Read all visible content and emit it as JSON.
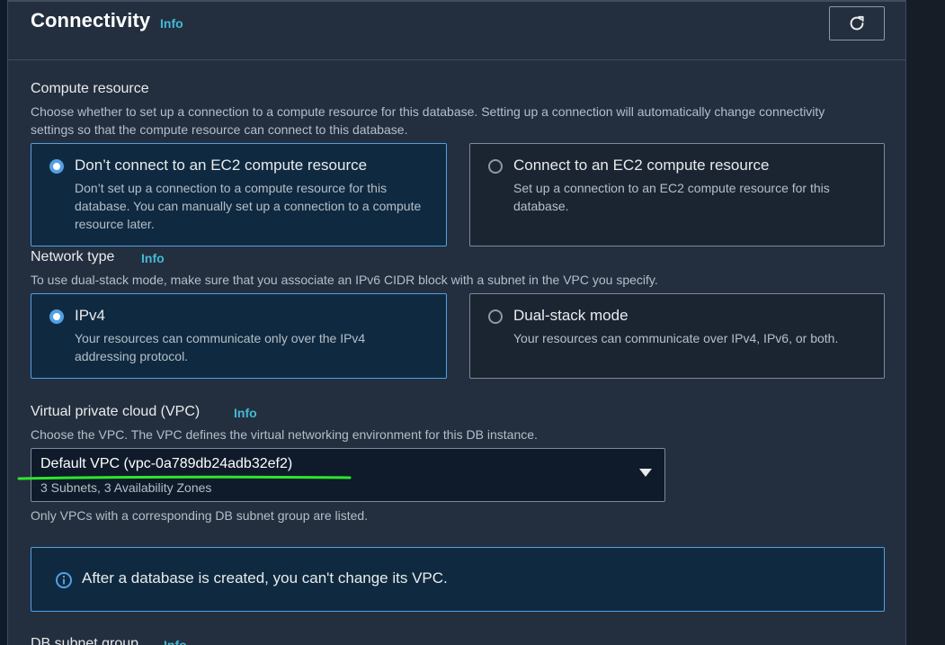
{
  "header": {
    "title": "Connectivity",
    "info": "Info",
    "refresh_icon": "refresh-icon"
  },
  "compute": {
    "label": "Compute resource",
    "description": "Choose whether to set up a connection to a compute resource for this database. Setting up a connection will automatically change connectivity settings so that the compute resource can connect to this database.",
    "options": [
      {
        "title": "Don’t connect to an EC2 compute resource",
        "description": "Don’t set up a connection to a compute resource for this database. You can manually set up a connection to a compute resource later.",
        "selected": true
      },
      {
        "title": "Connect to an EC2 compute resource",
        "description": "Set up a connection to an EC2 compute resource for this database.",
        "selected": false
      }
    ]
  },
  "network": {
    "label": "Network type",
    "info": "Info",
    "description": "To use dual-stack mode, make sure that you associate an IPv6 CIDR block with a subnet in the VPC you specify.",
    "options": [
      {
        "title": "IPv4",
        "description": "Your resources can communicate only over the IPv4 addressing protocol.",
        "selected": true
      },
      {
        "title": "Dual-stack mode",
        "description": "Your resources can communicate over IPv4, IPv6, or both.",
        "selected": false
      }
    ]
  },
  "vpc": {
    "label": "Virtual private cloud (VPC)",
    "info": "Info",
    "description": "Choose the VPC. The VPC defines the virtual networking environment for this DB instance.",
    "selected_value": "Default VPC (vpc-0a789db24adb32ef2)",
    "selected_sub": "3 Subnets, 3 Availability Zones",
    "hint": "Only VPCs with a corresponding DB subnet group are listed.",
    "annotation_color": "#2ee52e"
  },
  "alert": {
    "icon": "info-circle-icon",
    "text": "After a database is created, you can't change its VPC."
  },
  "subnet": {
    "label": "DB subnet group",
    "info": "Info"
  },
  "colors": {
    "accent": "#539fe5",
    "link": "#44b9d6",
    "panel": "#232f3e"
  }
}
